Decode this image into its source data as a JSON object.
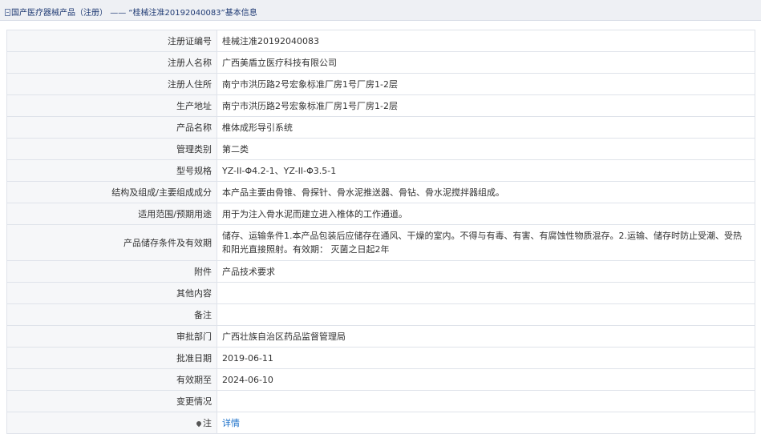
{
  "breadcrumb": {
    "category": "国产医疗器械产品（注册）",
    "separator": "——",
    "record": "“桂械注准20192040083”基本信息"
  },
  "rows": [
    {
      "label": "注册证编号",
      "value": "桂械注准20192040083"
    },
    {
      "label": "注册人名称",
      "value": "广西美盾立医疗科技有限公司"
    },
    {
      "label": "注册人住所",
      "value": "南宁市洪历路2号宏象标准厂房1号厂房1-2层"
    },
    {
      "label": "生产地址",
      "value": "南宁市洪历路2号宏象标准厂房1号厂房1-2层"
    },
    {
      "label": "产品名称",
      "value": "椎体成形导引系统"
    },
    {
      "label": "管理类别",
      "value": "第二类"
    },
    {
      "label": "型号规格",
      "value": "YZ-II-Φ4.2-1、YZ-II-Φ3.5-1"
    },
    {
      "label": "结构及组成/主要组成成分",
      "value": "本产品主要由骨锥、骨探针、骨水泥推送器、骨钻、骨水泥搅拌器组成。"
    },
    {
      "label": "适用范围/预期用途",
      "value": "用于为注入骨水泥而建立进入椎体的工作通道。"
    },
    {
      "label": "产品储存条件及有效期",
      "value": "储存、运输条件1.本产品包装后应储存在通风、干燥的室内。不得与有毒、有害、有腐蚀性物质混存。2.运输、储存时防止受潮、受热和阳光直接照射。有效期： 灭菌之日起2年"
    },
    {
      "label": "附件",
      "value": "产品技术要求"
    },
    {
      "label": "其他内容",
      "value": ""
    },
    {
      "label": "备注",
      "value": ""
    },
    {
      "label": "审批部门",
      "value": "广西壮族自治区药品监督管理局"
    },
    {
      "label": "批准日期",
      "value": "2019-06-11"
    },
    {
      "label": "有效期至",
      "value": "2024-06-10"
    },
    {
      "label": "变更情况",
      "value": ""
    }
  ],
  "note": {
    "label": "注",
    "link": "详情",
    "icon": "pin-icon"
  }
}
